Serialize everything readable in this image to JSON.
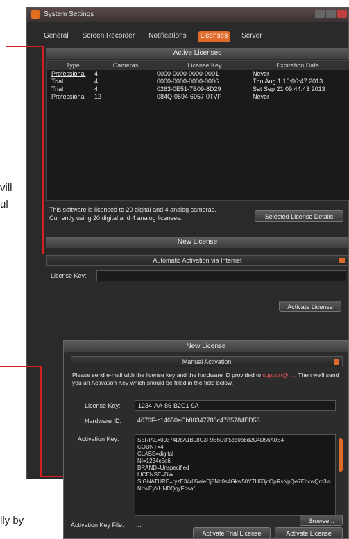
{
  "side_text": {
    "a": "vill",
    "b": "ul",
    "c": "lly by"
  },
  "window": {
    "title": "System Settings",
    "tabs": [
      {
        "label": "General"
      },
      {
        "label": "Screen Recorder"
      },
      {
        "label": "Notifications"
      },
      {
        "label": "Licenses"
      },
      {
        "label": "Server"
      }
    ],
    "active_section": "Active Licenses",
    "table": {
      "headers": [
        "Type",
        "Cameras",
        "License Key",
        "Expiration Date"
      ],
      "rows": [
        {
          "type": "Professional",
          "cameras": "4",
          "key": "0000-0000-0000-0001",
          "exp": "Never"
        },
        {
          "type": "Trial",
          "cameras": "4",
          "key": "0000-0000-0000-0006",
          "exp": "Thu Aug 1 16:06:47 2013"
        },
        {
          "type": "Trial",
          "cameras": "4",
          "key": "0263-0E51-7B09-8D29",
          "exp": "Sat Sep 21 09:44:43 2013"
        },
        {
          "type": "Professional",
          "cameras": "12",
          "key": "084Q-0594-6957-0TVP",
          "exp": "Never"
        }
      ]
    },
    "info_line1": "This software is licensed to 20 digital and 4 analog cameras.",
    "info_line2": "Currently using 20 digital and 4 analog licenses.",
    "details_button": "Selected License Details",
    "new_license_header": "New License",
    "activation_mode": "Automatic Activation via Internet",
    "license_key_label": "License Key:",
    "license_key_placeholder": "- - - - - - -",
    "activate_button": "Activate License"
  },
  "dialog": {
    "header": "New License",
    "mode": "Manual Activation",
    "note_pre": "Please send e-mail with the license key and the hardware ID provided to",
    "email": "support@...",
    "note_post": ". Then we'll send you an Activation Key which should be filled in the field below.",
    "license_key_label": "License Key:",
    "license_key_value": "1234-AA-86-B2C1-9A",
    "hardware_id_label": "Hardware ID:",
    "hardware_id_value": "4070F-c14650eCb80347788c4785784ED53",
    "activation_key_label": "Activation Key:",
    "activation_key_value": "SERIAL=00374DbA1B08C3F9E6D3f5cd0b8d2C4D56A0E4\nCOUNT=4\nCLASS=digital\nNI=1234c5e6\nBRAND=Unspecified\nLICENSE=DW\nSIGNATURE=ryzE34r05wieDj8Nb0s4Gkw50YTH63jcOpRsNpQe7EbcwQm3wNbwEyYHNDQqyFdsaf...",
    "activation_file_label": "Activation Key File:",
    "activation_file_value": "...",
    "browse_button": "Browse...",
    "activate_trial_button": "Activate Trial License",
    "activate_button": "Activate License"
  },
  "colors": {
    "accent": "#e06a2a",
    "callout": "#d42020",
    "email": "#e05050"
  }
}
